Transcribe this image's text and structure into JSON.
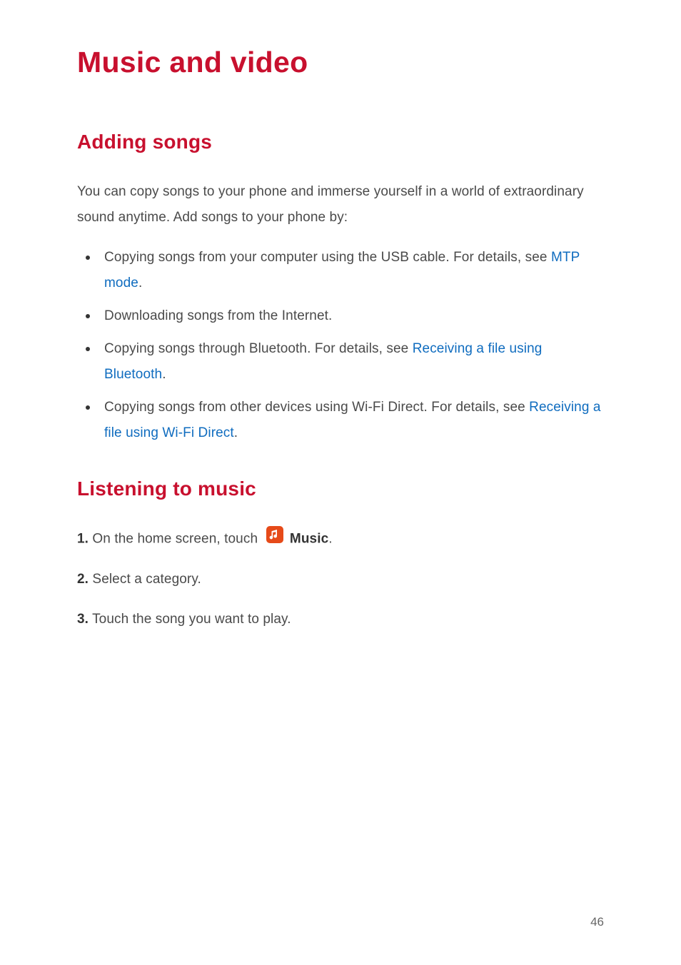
{
  "colors": {
    "heading": "#c8102e",
    "link": "#0f6cbf",
    "icon_bg": "#e64a19",
    "icon_fg": "#ffffff"
  },
  "doc_title": "Music and video",
  "section1": {
    "heading": "Adding songs",
    "intro": "You can copy songs to your phone and immerse yourself in a world of extraordinary sound anytime. Add songs to your phone by:",
    "items": [
      {
        "pre": "Copying songs from your computer using the USB cable. For details, see ",
        "link": "MTP mode",
        "post": "."
      },
      {
        "pre": "Downloading songs from the Internet.",
        "link": "",
        "post": ""
      },
      {
        "pre": "Copying songs through Bluetooth. For details, see ",
        "link": "Receiving a file using Bluetooth",
        "post": "."
      },
      {
        "pre": "Copying songs from other devices using Wi-Fi Direct. For details, see ",
        "link": "Receiving a file using Wi-Fi Direct",
        "post": "."
      }
    ]
  },
  "section2": {
    "heading": "Listening to music",
    "steps": [
      {
        "num": "1.",
        "pre": " On the home screen, touch ",
        "icon": "music-icon",
        "bold": "Music",
        "post": "."
      },
      {
        "num": "2.",
        "pre": " Select a category.",
        "icon": "",
        "bold": "",
        "post": ""
      },
      {
        "num": "3.",
        "pre": " Touch the song you want to play.",
        "icon": "",
        "bold": "",
        "post": ""
      }
    ]
  },
  "page_number": "46"
}
